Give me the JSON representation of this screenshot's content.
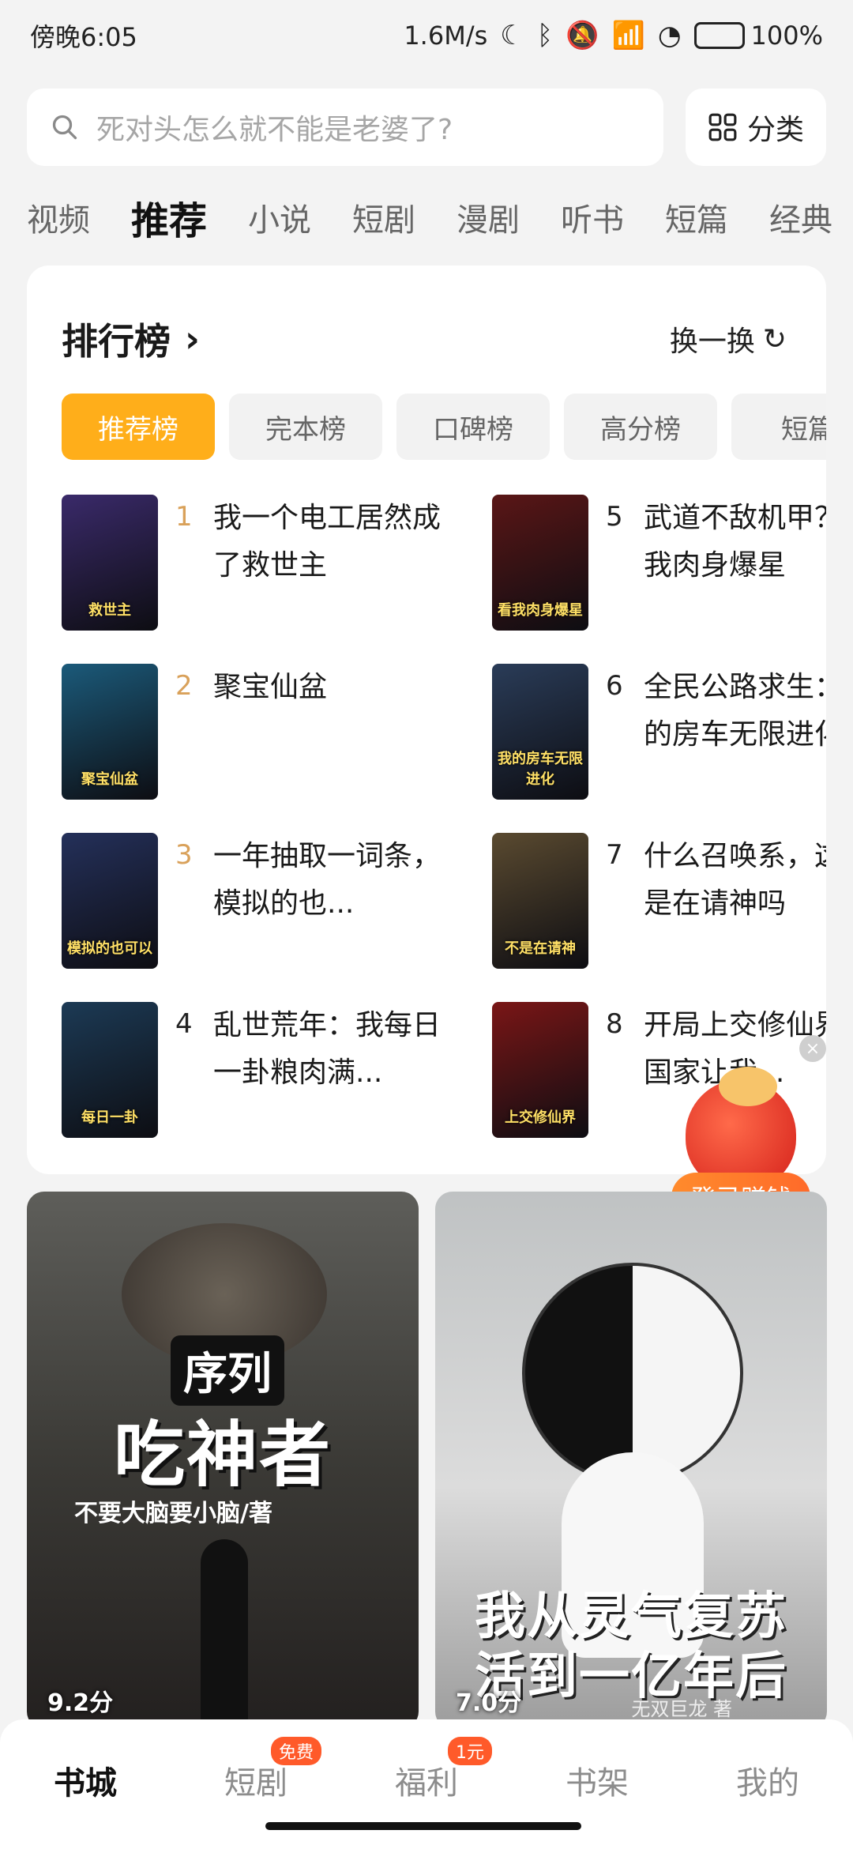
{
  "status_bar": {
    "time": "傍晚6:05",
    "speed": "1.6M/s",
    "battery": "100%"
  },
  "search": {
    "placeholder": "死对头怎么就不能是老婆了?",
    "category_label": "分类"
  },
  "channel_tabs": [
    "视频",
    "推荐",
    "小说",
    "短剧",
    "漫剧",
    "听书",
    "短篇",
    "经典"
  ],
  "ranking": {
    "title": "排行榜",
    "refresh": "换一换",
    "tabs": [
      "推荐榜",
      "完本榜",
      "口碑榜",
      "高分榜",
      "短篇"
    ],
    "items": [
      {
        "rank": "1",
        "title": "我一个电工居然成了救世主",
        "cover_text": "救世主",
        "cover_color": "#3a2a6a"
      },
      {
        "rank": "2",
        "title": "聚宝仙盆",
        "cover_text": "聚宝仙盆",
        "cover_color": "#1b5a7a"
      },
      {
        "rank": "3",
        "title": "一年抽取一词条，模拟的也...",
        "cover_text": "模拟的也可以",
        "cover_color": "#24305a"
      },
      {
        "rank": "4",
        "title": "乱世荒年：我每日一卦粮肉满...",
        "cover_text": "每日一卦",
        "cover_color": "#1c3a55"
      },
      {
        "rank": "5",
        "title": "武道不敌机甲？看我肉身爆星",
        "cover_text": "看我肉身爆星",
        "cover_color": "#5a1616"
      },
      {
        "rank": "6",
        "title": "全民公路求生：我的房车无限进化",
        "cover_text": "我的房车无限进化",
        "cover_color": "#2a3c58"
      },
      {
        "rank": "7",
        "title": "什么召唤系，这不是在请神吗",
        "cover_text": "不是在请神",
        "cover_color": "#5a4a30"
      },
      {
        "rank": "8",
        "title": "开局上交修仙界，国家让我...",
        "cover_text": "上交修仙界",
        "cover_color": "#7a1616"
      }
    ]
  },
  "bonus": {
    "label": "登录赚钱",
    "close": "×"
  },
  "features": [
    {
      "series": "序列",
      "title": "吃神者",
      "author": "不要大脑要小脑/著",
      "score": "9.2分"
    },
    {
      "title": "我从灵气复苏活到一亿年后",
      "author": "无双巨龙 著",
      "score": "7.0分"
    }
  ],
  "bottom_nav": [
    {
      "label": "书城",
      "badge": ""
    },
    {
      "label": "短剧",
      "badge": "免费"
    },
    {
      "label": "福利",
      "badge": "1元"
    },
    {
      "label": "书架",
      "badge": ""
    },
    {
      "label": "我的",
      "badge": ""
    }
  ],
  "colors": {
    "accent": "#ffae1a",
    "rank_top": "#d9a15a",
    "badge": "#ff5a2a"
  }
}
